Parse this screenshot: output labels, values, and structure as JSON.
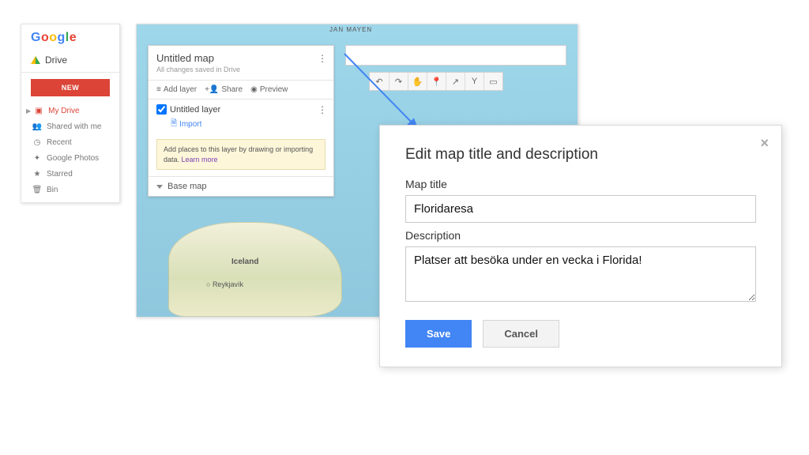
{
  "drive": {
    "logo_chars": [
      "G",
      "o",
      "o",
      "g",
      "l",
      "e"
    ],
    "product": "Drive",
    "new_button": "NEW",
    "nav": [
      {
        "label": "My Drive",
        "icon": "folder",
        "active": true
      },
      {
        "label": "Shared with me",
        "icon": "people"
      },
      {
        "label": "Recent",
        "icon": "clock"
      },
      {
        "label": "Google Photos",
        "icon": "photos"
      },
      {
        "label": "Starred",
        "icon": "star"
      },
      {
        "label": "Bin",
        "icon": "trash"
      }
    ]
  },
  "mymaps": {
    "title": "Untitled map",
    "status": "All changes saved in Drive",
    "actions": {
      "add_layer": "Add layer",
      "share": "Share",
      "preview": "Preview"
    },
    "layer": {
      "name": "Untitled layer",
      "import": "Import"
    },
    "hint_text": "Add places to this layer by drawing or importing data. ",
    "hint_link": "Learn more",
    "base_map": "Base map",
    "map_labels": {
      "jan_mayen": "JAN MAYEN",
      "iceland": "Iceland",
      "reykjavik": "Reykjavík"
    },
    "toolbar_icons": [
      "undo",
      "redo",
      "hand",
      "marker",
      "line",
      "directions",
      "ruler"
    ]
  },
  "modal": {
    "heading": "Edit map title and description",
    "title_label": "Map title",
    "title_value": "Floridaresa",
    "desc_label": "Description",
    "desc_value": "Platser att besöka under en vecka i Florida!",
    "save": "Save",
    "cancel": "Cancel"
  }
}
